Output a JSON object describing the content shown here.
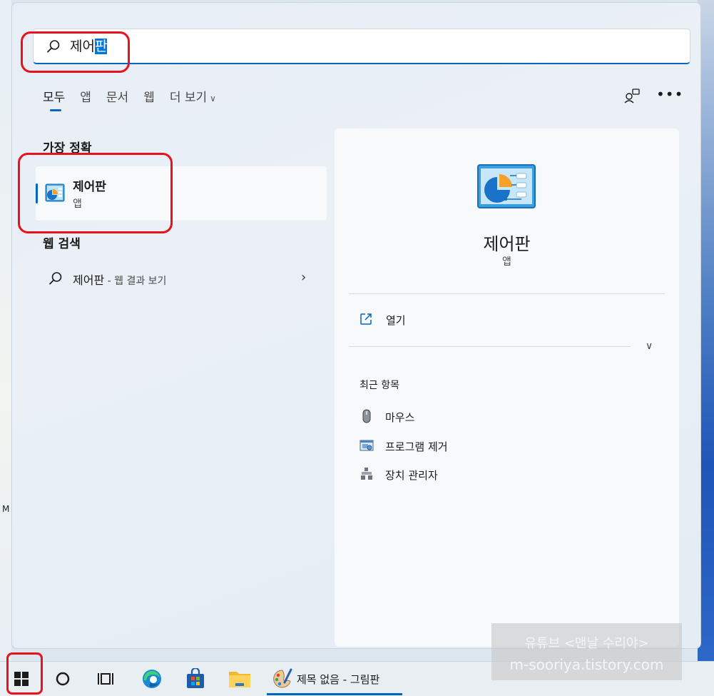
{
  "search": {
    "query_plain": "제어",
    "query_selected": "판"
  },
  "tabs": [
    {
      "label": "모두"
    },
    {
      "label": "앱"
    },
    {
      "label": "문서"
    },
    {
      "label": "웹"
    },
    {
      "label": "더 보기"
    }
  ],
  "best_match": {
    "heading": "가장 정확",
    "name": "제어판",
    "type": "앱"
  },
  "web_search": {
    "heading": "웹 검색",
    "query": "제어판",
    "suffix": " - 웹 결과 보기"
  },
  "detail": {
    "title": "제어판",
    "subtitle": "앱",
    "open_label": "열기",
    "recent_heading": "최근 항목",
    "recent_items": [
      {
        "label": "마우스",
        "icon": "mouse-icon"
      },
      {
        "label": "프로그램 제거",
        "icon": "programs-icon"
      },
      {
        "label": "장치 관리자",
        "icon": "device-manager-icon"
      }
    ]
  },
  "taskbar": {
    "active_window": "제목 없음 - 그림판"
  },
  "watermark": {
    "line1": "유튜브 <맨날 수리야>",
    "line2": "m-sooriya.tistory.com"
  },
  "desktop": {
    "stray_label": "M"
  },
  "colors": {
    "accent": "#0067c0",
    "highlight_box": "#e8121c"
  }
}
